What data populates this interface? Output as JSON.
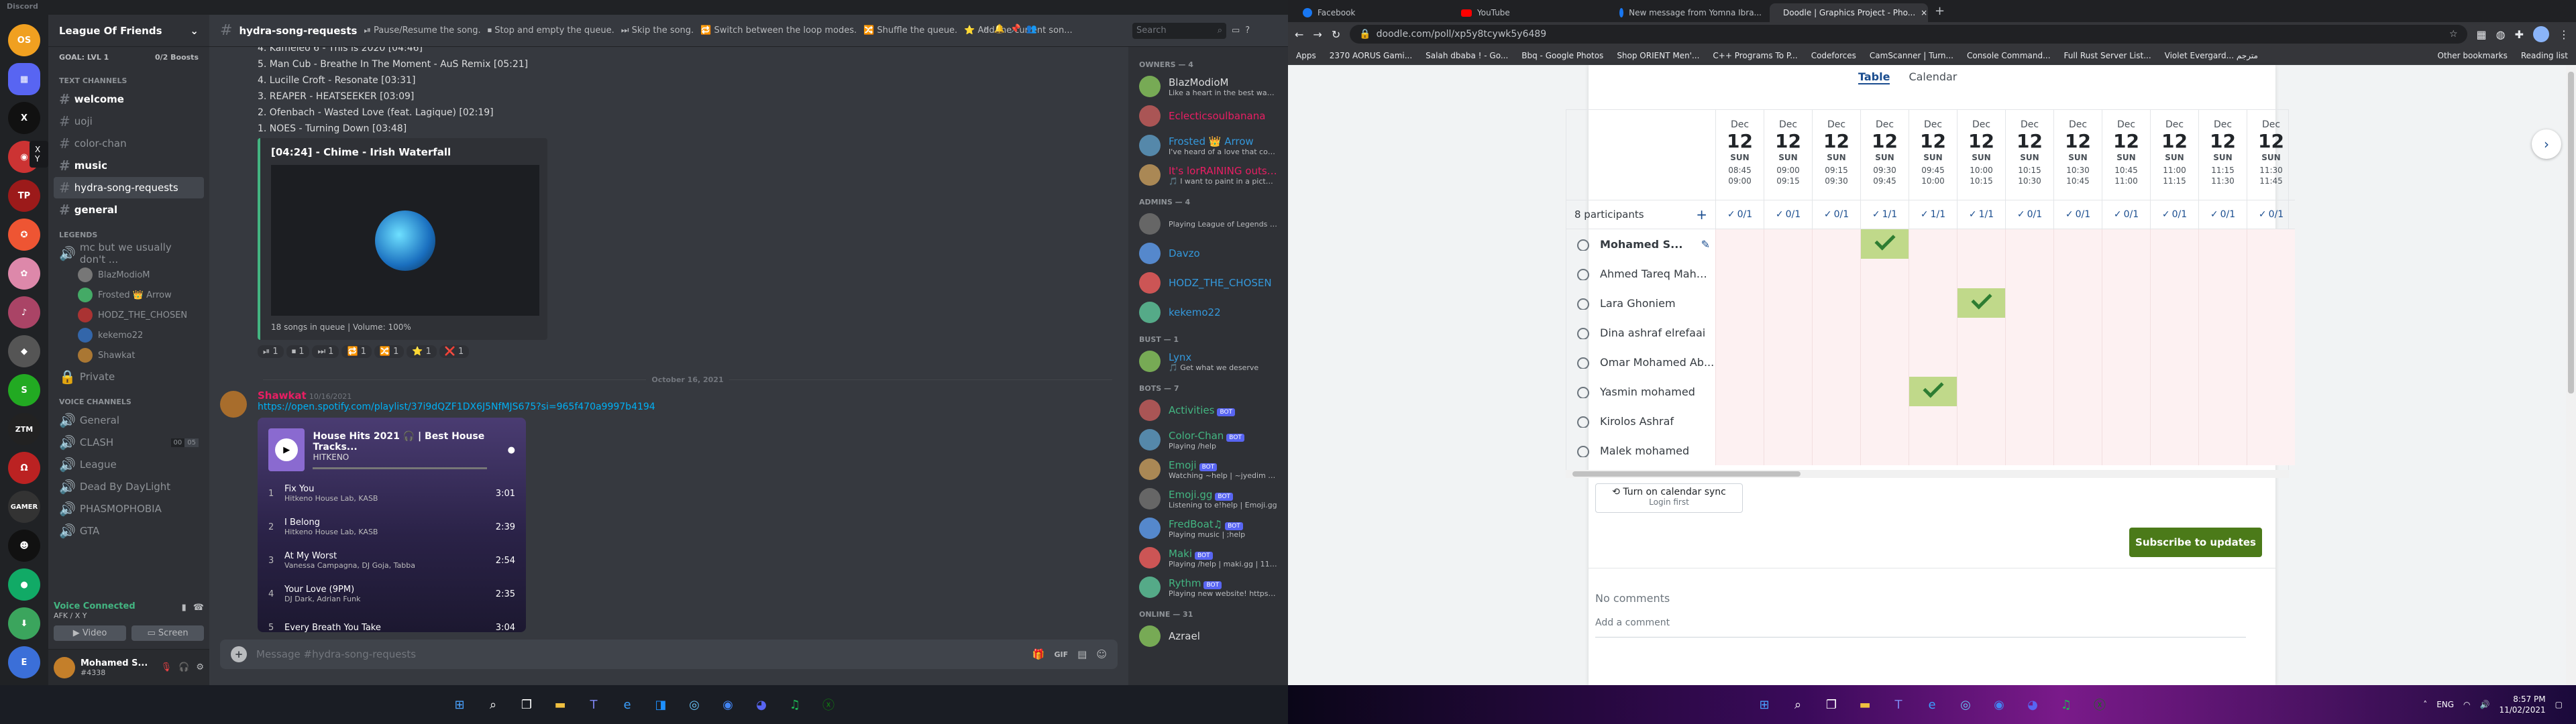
{
  "left": {
    "app_title": "Discord",
    "server": {
      "name": "League Of Friends",
      "goal": "GOAL: LVL 1",
      "boosts": "0/2 Boosts"
    },
    "categories": {
      "text": "TEXT CHANNELS",
      "legends": "LEGENDS",
      "voice": "VOICE CHANNELS"
    },
    "text_channels": [
      "welcome",
      "uoji",
      "color-chan",
      "music",
      "hydra-song-requests",
      "general"
    ],
    "legend_channel": "mc but we usually don't ...",
    "legend_users": [
      "BlazModioM",
      "Frosted 👑 Arrow",
      "HODZ_THE_CHOSEN",
      "kekemo22",
      "Shawkat"
    ],
    "private_channel": "Private",
    "voice_channels": [
      "General",
      "CLASH",
      "League",
      "Dead By DayLight",
      "PHASMOPHOBIA",
      "GTA"
    ],
    "clash_counts": {
      "a": "00",
      "b": "05"
    },
    "voice_status": "Voice Connected",
    "voice_sub": "AFK / X Y",
    "video_label": "Video",
    "screen_label": "Screen",
    "user": {
      "name": "Mohamed S...",
      "tag": "#4338"
    },
    "tooltip": "X Y",
    "chat": {
      "channel": "hydra-song-requests",
      "topic": [
        "⏯ Pause/Resume the song.",
        "⏹ Stop and empty the queue.",
        "⏭ Skip the song.",
        "🔁 Switch between the loop modes.",
        "🔀 Shuffle the queue.",
        "⭐ Add the current son..."
      ],
      "search_placeholder": "Search",
      "queue": [
        "4. Kameleo 6 - This is 2020 [04:46]",
        "5. Man Cub - Breathe In The Moment - AuS Remix [05:21]",
        "4. Lucille Croft - Resonate [03:31]",
        "3. REAPER - HEATSEEKER [03:09]",
        "2. Ofenbach - Wasted Love (feat. Lagique) [02:19]",
        "1. NOES - Turning Down [03:48]"
      ],
      "now_playing": "[04:24] - Chime - Irish Waterfall",
      "embed_footer": "18 songs in queue | Volume: 100%",
      "reactions": [
        {
          "icon": "⏯",
          "count": "1"
        },
        {
          "icon": "⏹",
          "count": "1"
        },
        {
          "icon": "⏭",
          "count": "1"
        },
        {
          "icon": "🔁",
          "count": "1"
        },
        {
          "icon": "🔀",
          "count": "1"
        },
        {
          "icon": "⭐",
          "count": "1"
        },
        {
          "icon": "❌",
          "count": "1"
        }
      ],
      "date_divider": "October 16, 2021",
      "author": "Shawkat",
      "timestamp": "10/16/2021",
      "link": "https://open.spotify.com/playlist/37i9dQZF1DX6J5NfMJS675?si=965f470a9997b4194",
      "spotify": {
        "title": "House Hits 2021 🎧 | Best House Tracks...",
        "subtitle": "HITKENO",
        "tracks": [
          {
            "n": "1",
            "title": "Fix You",
            "artist": "Hitkeno House Lab, KASB",
            "time": "3:01"
          },
          {
            "n": "2",
            "title": "I Belong",
            "artist": "Hitkeno House Lab, KASB",
            "time": "2:39"
          },
          {
            "n": "3",
            "title": "At My Worst",
            "artist": "Vanessa Campagna, DJ Goja, Tabba",
            "time": "2:54"
          },
          {
            "n": "4",
            "title": "Your Love (9PM)",
            "artist": "DJ Dark, Adrian Funk",
            "time": "2:35"
          },
          {
            "n": "5",
            "title": "Every Breath You Take",
            "artist": "",
            "time": "3:04"
          }
        ]
      },
      "composer_placeholder": "Message #hydra-song-requests"
    },
    "members": {
      "owners_header": "OWNERS — 4",
      "owners": [
        {
          "name": "BlazModioM",
          "status": "Like a heart in the best way elt...",
          "color": "#dcddde"
        },
        {
          "name": "Eclecticsoulbanana",
          "status": "",
          "color": "#e91e63"
        },
        {
          "name": "Frosted 👑 Arrow",
          "status": "I've heard of a love that comes...",
          "color": "#3498db"
        },
        {
          "name": "It's lorRAINING outside",
          "status": "🎵 I want to paint in a picture 1...",
          "color": "#e91e63"
        }
      ],
      "admins_header": "ADMINS — 4",
      "admins": [
        {
          "name": "",
          "status": "Playing League of Legends 🎮",
          "color": "#71368a"
        },
        {
          "name": "Davzo",
          "status": "",
          "color": "#3498db"
        },
        {
          "name": "HODZ_THE_CHOSEN",
          "status": "",
          "color": "#3498db"
        },
        {
          "name": "kekemo22",
          "status": "",
          "color": "#3498db"
        }
      ],
      "bust_header": "BUST — 1",
      "bust": [
        {
          "name": "Lynx",
          "status": "🎵 Get what we deserve",
          "color": "#3498db"
        }
      ],
      "bots_header": "BOTS — 7",
      "bots": [
        {
          "name": "Activities",
          "status": "",
          "color": "#43b581"
        },
        {
          "name": "Color-Chan",
          "status": "Playing /help",
          "color": "#43b581"
        },
        {
          "name": "Emoji",
          "status": "Watching ~help | ~jyedim | e...",
          "color": "#43b581"
        },
        {
          "name": "Emoji.gg",
          "status": "Listening to e!help | Emoji.gg",
          "color": "#43b581"
        },
        {
          "name": "FredBoat♫",
          "status": "Playing music | ;help",
          "color": "#43b581"
        },
        {
          "name": "Maki",
          "status": "Playing /help | maki.gg | 113,529...",
          "color": "#43b581"
        },
        {
          "name": "Rythm",
          "status": "Playing new website! https://...",
          "color": "#43b581"
        }
      ],
      "bot_tag": "BOT",
      "online_header": "ONLINE — 31",
      "online": [
        {
          "name": "Azrael",
          "status": "",
          "color": "#dcddde"
        }
      ]
    }
  },
  "right": {
    "tabs": [
      {
        "title": "Facebook",
        "color": "#1877f2"
      },
      {
        "title": "YouTube",
        "color": "#ff0000"
      },
      {
        "title": "New message from Yomna Ibra...",
        "color": "#1877f2"
      },
      {
        "title": "Doodle | Graphics Project - Pho...",
        "color": "#1a4d8f"
      }
    ],
    "url": "doodle.com/poll/xp5y8tcywk5y6489",
    "bookmarks": [
      "Apps",
      "2370 AORUS Gami...",
      "Salah dbaba ! - Go...",
      "Bbq - Google Photos",
      "Shop ORIENT Men'...",
      "C++ Programs To P...",
      "Codeforces",
      "CamScanner | Turn...",
      "Console Command...",
      "Full Rust Server List...",
      "Violet Evergard... مترجم"
    ],
    "bookmarks_right": [
      "Other bookmarks",
      "Reading list"
    ],
    "view_table": "Table",
    "view_calendar": "Calendar",
    "participants_label": "8 participants",
    "columns": [
      {
        "m": "Dec",
        "d": "12",
        "w": "SUN",
        "t1": "08:45",
        "t2": "09:00",
        "c": "0/1"
      },
      {
        "m": "Dec",
        "d": "12",
        "w": "SUN",
        "t1": "09:00",
        "t2": "09:15",
        "c": "0/1"
      },
      {
        "m": "Dec",
        "d": "12",
        "w": "SUN",
        "t1": "09:15",
        "t2": "09:30",
        "c": "0/1"
      },
      {
        "m": "Dec",
        "d": "12",
        "w": "SUN",
        "t1": "09:30",
        "t2": "09:45",
        "c": "1/1"
      },
      {
        "m": "Dec",
        "d": "12",
        "w": "SUN",
        "t1": "09:45",
        "t2": "10:00",
        "c": "1/1"
      },
      {
        "m": "Dec",
        "d": "12",
        "w": "SUN",
        "t1": "10:00",
        "t2": "10:15",
        "c": "1/1"
      },
      {
        "m": "Dec",
        "d": "12",
        "w": "SUN",
        "t1": "10:15",
        "t2": "10:30",
        "c": "0/1"
      },
      {
        "m": "Dec",
        "d": "12",
        "w": "SUN",
        "t1": "10:30",
        "t2": "10:45",
        "c": "0/1"
      },
      {
        "m": "Dec",
        "d": "12",
        "w": "SUN",
        "t1": "10:45",
        "t2": "11:00",
        "c": "0/1"
      },
      {
        "m": "Dec",
        "d": "12",
        "w": "SUN",
        "t1": "11:00",
        "t2": "11:15",
        "c": "0/1"
      },
      {
        "m": "Dec",
        "d": "12",
        "w": "SUN",
        "t1": "11:15",
        "t2": "11:30",
        "c": "0/1"
      },
      {
        "m": "Dec",
        "d": "12",
        "w": "SUN",
        "t1": "11:30",
        "t2": "11:45",
        "c": "0/1"
      }
    ],
    "participants": [
      {
        "name": "Mohamed S...",
        "yes": [
          3
        ]
      },
      {
        "name": "Ahmed Tareq Mahm...",
        "yes": []
      },
      {
        "name": "Lara Ghoniem",
        "yes": [
          5
        ]
      },
      {
        "name": "Dina ashraf elrefaai",
        "yes": []
      },
      {
        "name": "Omar Mohamed Ab...",
        "yes": []
      },
      {
        "name": "Yasmin mohamed",
        "yes": [
          4
        ]
      },
      {
        "name": "Kirolos Ashraf",
        "yes": []
      },
      {
        "name": "Malek mohamed",
        "yes": []
      }
    ],
    "calendar_sync": "Turn on calendar sync",
    "login_first": "Login first",
    "subscribe": "Subscribe to updates",
    "no_comments": "No comments",
    "add_comment": "Add a comment"
  },
  "taskbar_right": {
    "lang": "ENG",
    "time": "8:57 PM",
    "date": "11/02/2021"
  },
  "colors": {
    "discord_bg": "#36393f",
    "discord_accent": "#5865f2",
    "doodle_blue": "#1a4d8f",
    "doodle_green": "#4b7a19",
    "yes_cell": "#c0d98a"
  }
}
